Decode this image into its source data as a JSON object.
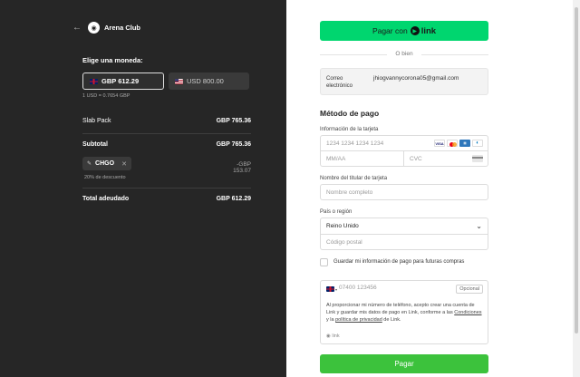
{
  "merchant": {
    "name": "Arena Club"
  },
  "currency": {
    "title": "Elige una moneda:",
    "options": [
      {
        "code": "GBP",
        "label": "GBP 612.29",
        "selected": true
      },
      {
        "code": "USD",
        "label": "USD 800.00",
        "selected": false
      }
    ],
    "rate": "1 USD = 0.7654 GBP"
  },
  "summary": {
    "item_label": "Slab Pack",
    "item_value": "GBP 765.36",
    "subtotal_label": "Subtotal",
    "subtotal_value": "GBP 765.36",
    "coupon_code": "CHGO",
    "discount_value": "-GBP 153.07",
    "discount_note": "20% de descuento",
    "total_label": "Total adeudado",
    "total_value": "GBP 612.29"
  },
  "link_button": {
    "prefix": "Pagar con",
    "brand": "link"
  },
  "or_text": "O bien",
  "email": {
    "label": "Correo electrónico",
    "value": "jhiogvannycorona05@gmail.com"
  },
  "payment": {
    "title": "Método de pago",
    "card_label": "Información de la tarjeta",
    "card_placeholder": "1234 1234 1234 1234",
    "expiry_placeholder": "MM/AA",
    "cvc_placeholder": "CVC",
    "card_brands": [
      "VISA",
      "Mastercard",
      "Amex",
      "Diners"
    ],
    "name_label": "Nombre del titular de tarjeta",
    "name_placeholder": "Nombre completo",
    "country_label": "País o región",
    "country_value": "Reino Unido",
    "postal_placeholder": "Código postal"
  },
  "save": {
    "label": "Guardar mi información de pago para futuras compras",
    "checked": false
  },
  "phone": {
    "placeholder": "07400 123456",
    "optional": "Opcional",
    "legal_1": "Al proporcionar mi número de teléfono, acepto crear una cuenta de Link y guardar mis datos de pago en Link, conforme a las ",
    "conditions": "Condiciones",
    "legal_2": " y la ",
    "privacy": "política de privacidad",
    "legal_3": " de Link.",
    "footer": "link"
  },
  "pay_button": "Pagar",
  "colors": {
    "link_green": "#00d66f",
    "pay_green": "#3cc23c",
    "left_bg": "#262626"
  }
}
